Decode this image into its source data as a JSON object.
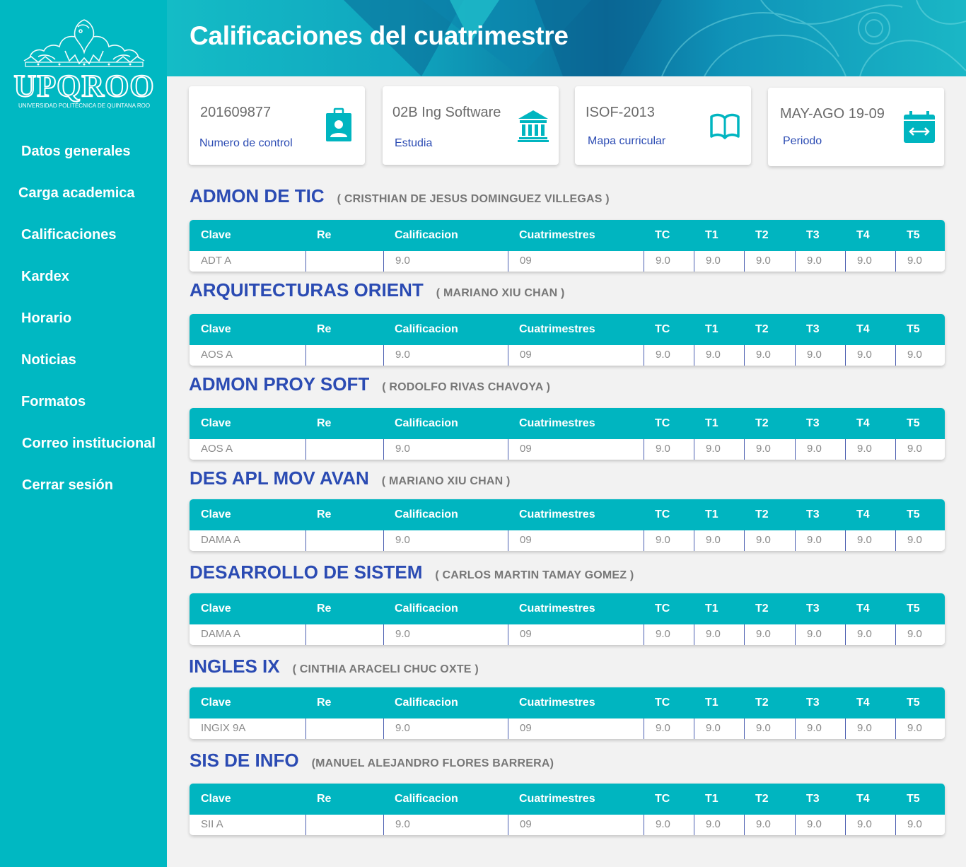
{
  "brand": {
    "name": "UPQROO",
    "subtitle": "UNIVERSIDAD POLITÉCNICA DE QUINTANA ROO"
  },
  "sidebar": {
    "items": [
      {
        "label": "Datos generales"
      },
      {
        "label": "Carga academica"
      },
      {
        "label": "Calificaciones"
      },
      {
        "label": "Kardex"
      },
      {
        "label": "Horario"
      },
      {
        "label": "Noticias"
      },
      {
        "label": "Formatos"
      },
      {
        "label": "Correo institucional"
      },
      {
        "label": "Cerrar sesión"
      }
    ]
  },
  "header": {
    "title": "Calificaciones del cuatrimestre"
  },
  "cards": [
    {
      "value": "201609877",
      "label": "Numero de control",
      "icon": "id-badge-icon"
    },
    {
      "value": "02B Ing Software",
      "label": "Estudia",
      "icon": "institution-icon"
    },
    {
      "value": "ISOF-2013",
      "label": "Mapa curricular",
      "icon": "book-icon"
    },
    {
      "value": "MAY-AGO 19-09",
      "label": "Periodo",
      "icon": "calendar-range-icon"
    }
  ],
  "table_headers": [
    "Clave",
    "Re",
    "Calificacion",
    "Cuatrimestres",
    "TC",
    "T1",
    "T2",
    "T3",
    "T4",
    "T5"
  ],
  "subjects": [
    {
      "name": "ADMON DE TIC",
      "teacher": "( CRISTHIAN DE JESUS DOMINGUEZ VILLEGAS )",
      "row": [
        "ADT A",
        "",
        "9.0",
        "09",
        "9.0",
        "9.0",
        "9.0",
        "9.0",
        "9.0",
        "9.0"
      ]
    },
    {
      "name": "ARQUITECTURAS ORIENT",
      "teacher": "( MARIANO XIU CHAN )",
      "row": [
        "AOS A",
        "",
        "9.0",
        "09",
        "9.0",
        "9.0",
        "9.0",
        "9.0",
        "9.0",
        "9.0"
      ]
    },
    {
      "name": "ADMON PROY SOFT",
      "teacher": "( RODOLFO RIVAS CHAVOYA  )",
      "row": [
        "AOS A",
        "",
        "9.0",
        "09",
        "9.0",
        "9.0",
        "9.0",
        "9.0",
        "9.0",
        "9.0"
      ]
    },
    {
      "name": "DES APL MOV AVAN",
      "teacher": "( MARIANO XIU CHAN )",
      "row": [
        "DAMA A",
        "",
        "9.0",
        "09",
        "9.0",
        "9.0",
        "9.0",
        "9.0",
        "9.0",
        "9.0"
      ]
    },
    {
      "name": "DESARROLLO DE SISTEM",
      "teacher": "( CARLOS MARTIN TAMAY GOMEZ )",
      "row": [
        "DAMA A",
        "",
        "9.0",
        "09",
        "9.0",
        "9.0",
        "9.0",
        "9.0",
        "9.0",
        "9.0"
      ]
    },
    {
      "name": "INGLES IX",
      "teacher": "( CINTHIA ARACELI CHUC OXTE )",
      "row": [
        "INGIX 9A",
        "",
        "9.0",
        "09",
        "9.0",
        "9.0",
        "9.0",
        "9.0",
        "9.0",
        "9.0"
      ]
    },
    {
      "name": "SIS DE INFO",
      "teacher": "(MANUEL ALEJANDRO FLORES BARRERA)",
      "row": [
        "SII A",
        "",
        "9.0",
        "09",
        "9.0",
        "9.0",
        "9.0",
        "9.0",
        "9.0",
        "9.0"
      ]
    }
  ],
  "colors": {
    "teal": "#00b8c2",
    "blue_text": "#2b4bb3",
    "gray_text": "#8a8a8a"
  }
}
